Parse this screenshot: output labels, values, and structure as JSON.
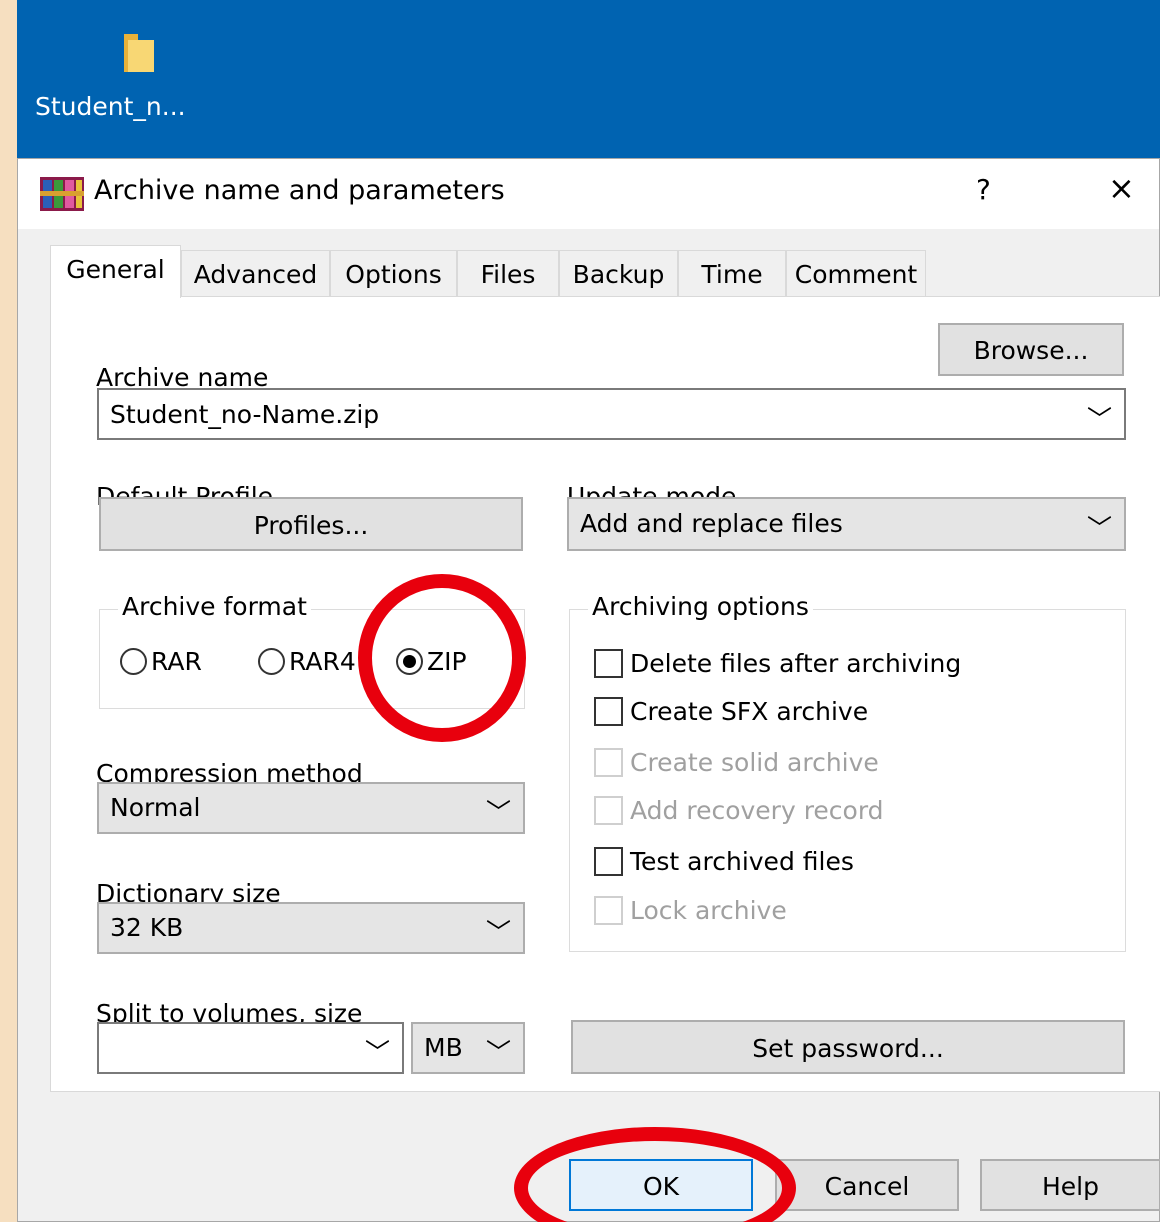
{
  "desktop": {
    "icon_label": "Student_n..."
  },
  "dialog": {
    "title": "Archive name and parameters",
    "help": "?",
    "close": "×"
  },
  "tabs": [
    "General",
    "Advanced",
    "Options",
    "Files",
    "Backup",
    "Time",
    "Comment"
  ],
  "general": {
    "archive_name_label": "Archive name",
    "browse_label": "Browse...",
    "archive_name_value": "Student_no-Name.zip",
    "default_profile_label": "Default Profile",
    "profiles_button": "Profiles...",
    "update_mode_label": "Update mode",
    "update_mode_value": "Add and replace files",
    "archive_format": {
      "label": "Archive format",
      "options": [
        "RAR",
        "RAR4",
        "ZIP"
      ],
      "selected": "ZIP"
    },
    "compression_label": "Compression method",
    "compression_value": "Normal",
    "dictionary_label": "Dictionary size",
    "dictionary_value": "32 KB",
    "split_label": "Split to volumes, size",
    "split_value": "",
    "split_unit": "MB",
    "archiving_options": {
      "label": "Archiving options",
      "delete_files": "Delete files after archiving",
      "create_sfx": "Create SFX archive",
      "create_solid": "Create solid archive",
      "add_recovery": "Add recovery record",
      "test_files": "Test archived files",
      "lock_archive": "Lock archive"
    },
    "set_password": "Set password..."
  },
  "footer": {
    "ok": "OK",
    "cancel": "Cancel",
    "help": "Help"
  },
  "chevron": "﹀",
  "colors": {
    "desktop": "#0063b1",
    "highlight_circle": "#e8000d",
    "frame": "#f6dfc0"
  }
}
